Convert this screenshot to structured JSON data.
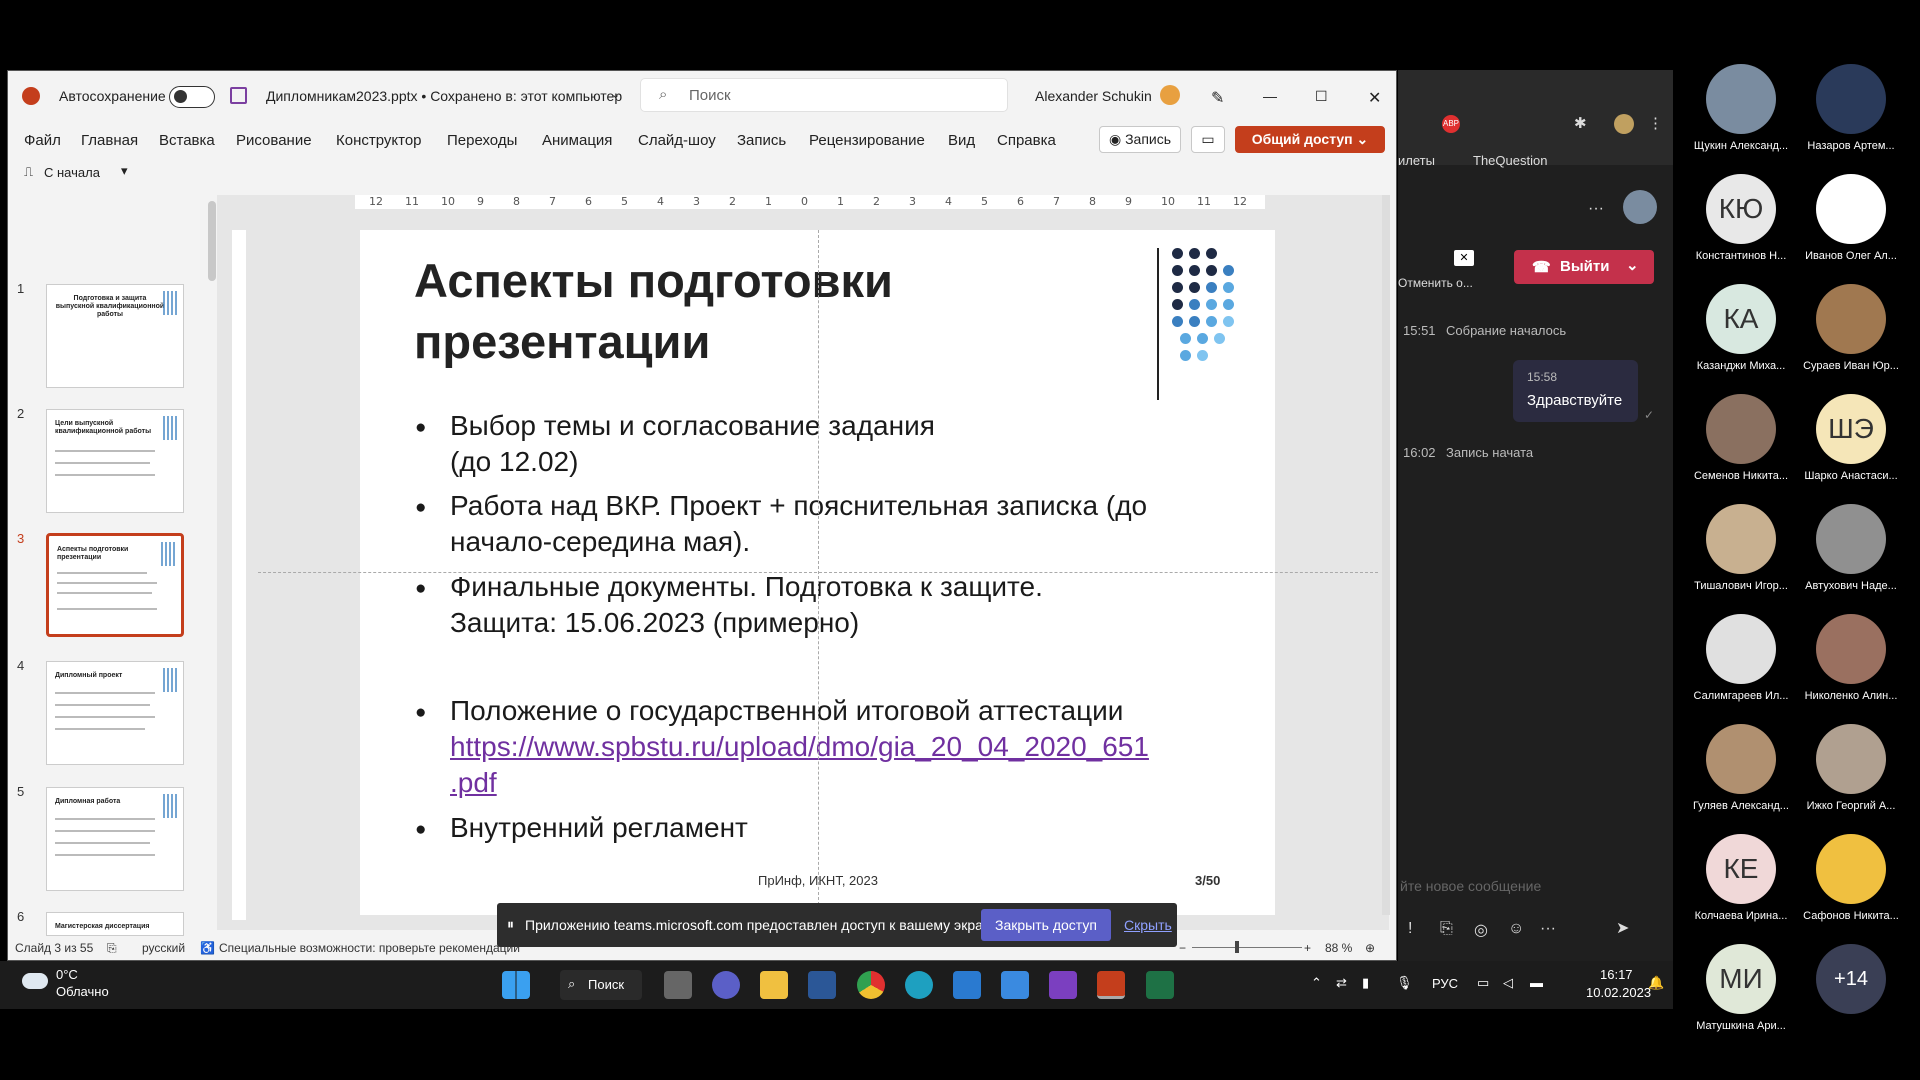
{
  "powerpoint": {
    "autosave_label": "Автосохранение",
    "file_title": "Дипломникам2023.pptx • Сохранено в: этот компьютер",
    "search_placeholder": "Поиск",
    "user_name": "Alexander Schukin",
    "menu": [
      "Файл",
      "Главная",
      "Вставка",
      "Рисование",
      "Конструктор",
      "Переходы",
      "Анимация",
      "Слайд-шоу",
      "Запись",
      "Рецензирование",
      "Вид",
      "Справка"
    ],
    "record_button": "Запись",
    "share_button": "Общий доступ",
    "from_start": "С начала",
    "ruler_ticks": [
      "12",
      "11",
      "10",
      "9",
      "8",
      "7",
      "6",
      "5",
      "4",
      "3",
      "2",
      "1",
      "0",
      "1",
      "2",
      "3",
      "4",
      "5",
      "6",
      "7",
      "8",
      "9",
      "10",
      "11",
      "12"
    ],
    "thumbnails": [
      {
        "num": "1",
        "title": "Подготовка и защита выпускной квалификационной работы"
      },
      {
        "num": "2",
        "title": "Цели выпускной квалификационной работы"
      },
      {
        "num": "3",
        "title": "Аспекты подготовки презентации"
      },
      {
        "num": "4",
        "title": "Дипломный проект"
      },
      {
        "num": "5",
        "title": "Дипломная работа"
      },
      {
        "num": "6",
        "title": "Магистерская диссертация"
      }
    ],
    "slide": {
      "title_line1": "Аспекты подготовки",
      "title_line2": "презентации",
      "b1_l1": "Выбор темы и согласование задания",
      "b1_l2": "(до 12.02)",
      "b2_l1": "Работа над ВКР. Проект + пояснительная записка (до",
      "b2_l2": "начало-середина мая).",
      "b3_l1": "Финальные документы. Подготовка к защите.",
      "b3_l2": "Защита: 15.06.2023 (примерно)",
      "b4_l1": "Положение о государственной итоговой аттестации",
      "b4_link1": "https://www.spbstu.ru/upload/dmo/gia_20_04_2020_651",
      "b4_link2": ".pdf",
      "b5": "Внутренний регламент",
      "footer": "ПрИнф, ИКНТ, 2023",
      "page": "3/50"
    },
    "status": {
      "slide_of": "Слайд 3 из 55",
      "language": "русский",
      "accessibility": "Специальные возможности: проверьте рекомендации",
      "zoom": "88 %"
    }
  },
  "share_notice": {
    "text": "Приложению teams.microsoft.com предоставлен доступ к вашему экрану.",
    "stop_button": "Закрыть доступ",
    "hide_link": "Скрыть"
  },
  "teams": {
    "browser_link": "TheQuestion",
    "browser_tab_prefix": "илеты",
    "unshare_label": "Отменить о...",
    "leave_button": "Выйти",
    "messages": [
      {
        "time": "15:51",
        "text": "Собрание началось"
      },
      {
        "time": "16:02",
        "text": "Запись начата"
      }
    ],
    "bubble_time": "15:58",
    "bubble_text": "Здравствуйте",
    "compose_placeholder": "йте новое сообщение"
  },
  "participants": [
    {
      "name": "Щукин Александ...",
      "initials": "",
      "color": "#7a8ca0"
    },
    {
      "name": "Назаров Артем...",
      "initials": "",
      "color": "#2a3a5a"
    },
    {
      "name": "Константинов Н...",
      "initials": "КЮ",
      "color": "#e8e8e8"
    },
    {
      "name": "Иванов Олег Ал...",
      "initials": "",
      "color": "#ffffff"
    },
    {
      "name": "Казанджи Миха...",
      "initials": "КА",
      "color": "#d8e8e0"
    },
    {
      "name": "Сураев Иван Юр...",
      "initials": "",
      "color": "#a07850"
    },
    {
      "name": "Семенов Никита...",
      "initials": "",
      "color": "#8a7060"
    },
    {
      "name": "Шарко Анастаси...",
      "initials": "ШЭ",
      "color": "#f5e6b8"
    },
    {
      "name": "Тишалович Игор...",
      "initials": "",
      "color": "#c8b090"
    },
    {
      "name": "Автухович Наде...",
      "initials": "",
      "color": "#909090"
    },
    {
      "name": "Салимгареев Ил...",
      "initials": "",
      "color": "#e0e0e0"
    },
    {
      "name": "Николенко Алин...",
      "initials": "",
      "color": "#9a7060"
    },
    {
      "name": "Гуляев Александ...",
      "initials": "",
      "color": "#b09070"
    },
    {
      "name": "Ижко Георгий А...",
      "initials": "",
      "color": "#b0a090"
    },
    {
      "name": "Колчаева Ирина...",
      "initials": "КЕ",
      "color": "#f0d8d8"
    },
    {
      "name": "Сафонов Никита...",
      "initials": "",
      "color": "#f0c040"
    },
    {
      "name": "Матушкина Ари...",
      "initials": "МИ",
      "color": "#e0e8d8"
    }
  ],
  "more_participants": "+14",
  "taskbar": {
    "temperature": "0°C",
    "weather": "Облачно",
    "search": "Поиск",
    "lang": "РУС",
    "time": "16:17",
    "date": "10.02.2023"
  }
}
